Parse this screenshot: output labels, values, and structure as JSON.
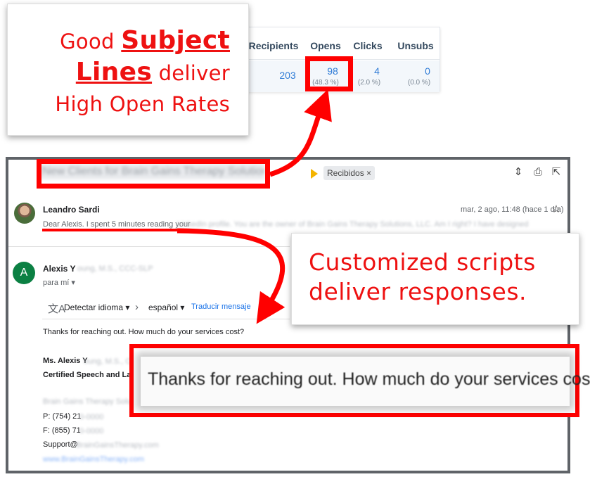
{
  "headline": {
    "word_good": "Good",
    "word_subject": "Subject",
    "word_lines": "Lines",
    "word_deliver": "deliver",
    "line3": "High Open Rates"
  },
  "stats": {
    "headers": [
      "Recipients",
      "Opens",
      "Clicks",
      "Unsubs"
    ],
    "recipients": "203",
    "opens": "98",
    "opens_pct": "(48.3 %)",
    "clicks": "4",
    "clicks_pct": "(2.0 %)",
    "unsubs": "0",
    "unsubs_pct": "(0.0 %)"
  },
  "email": {
    "subject": "New Clients for Brain Gains Therapy Solutions",
    "label": "Recibidos",
    "label_close": "×",
    "sender1": "Leandro Sardi",
    "date1": "mar, 2 ago, 11:48 (hace 1 día)",
    "preview_visible": "Dear Alexis. I spent 5 minutes reading your",
    "preview_blurred": "LinkedIn profile. You are the owner of Brain Gains Therapy Solutions, LLC. Am I right? I have designed a new system",
    "sender2_initial": "A",
    "sender2": "Alexis Y",
    "sender2_blur": "oung, M.S., CCC-SLP",
    "to_me": "para mí",
    "detect_lang": "Detectar idioma",
    "target_lang": "español",
    "translate": "Traducir mensaje",
    "reply_body": "Thanks for reaching out. How much do your services cost?",
    "sig_name": "Ms. Alexis Y",
    "sig_name_blur": "oung, M.S., CCC-SLP",
    "sig_title": "Certified Speech and Lang",
    "sig_company_blur": "Brain Gains Therapy Solutions",
    "phone": "P: (754) 21",
    "phone_blur": "0-0000",
    "fax": "F: (855) 71",
    "fax_blur": "0-0000",
    "support": "Support@",
    "support_blur": "BrainGainsTherapy.com",
    "website_blur": "www.BrainGainsTherapy.com"
  },
  "callout": {
    "line1": "Customized scripts",
    "line2": "deliver responses."
  },
  "zoom": {
    "text": "Thanks for reaching out. How much do your services cost?"
  },
  "colors": {
    "annotation_red": "#ff0000",
    "headline_red": "#ee1111",
    "link_blue": "#2e7bd6",
    "avatar_green": "#0b8043"
  }
}
